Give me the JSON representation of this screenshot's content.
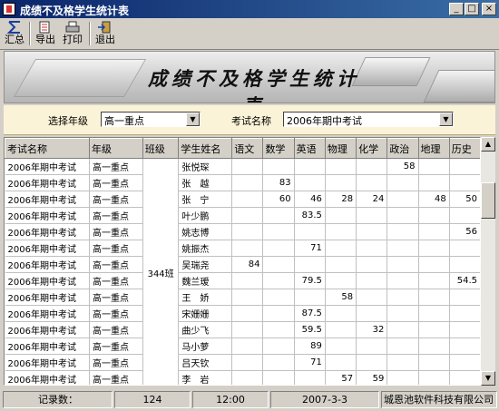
{
  "window": {
    "title": "成绩不及格学生统计表",
    "min": "_",
    "max": "□",
    "close": "×"
  },
  "toolbar": {
    "summary": "汇总",
    "export": "导出",
    "print": "打印",
    "exit": "退出"
  },
  "banner": {
    "title": "成绩不及格学生统计表"
  },
  "filters": {
    "grade_label": "选择年级",
    "grade_value": "高一重点",
    "exam_label": "考试名称",
    "exam_value": "2006年期中考试"
  },
  "table": {
    "columns": [
      "考试名称",
      "年级",
      "班级",
      "学生姓名",
      "语文",
      "数学",
      "英语",
      "物理",
      "化学",
      "政治",
      "地理",
      "历史"
    ],
    "class_name": "344班",
    "rows": [
      [
        "2006年期中考试",
        "高一重点",
        "张悦琛",
        "",
        "",
        "",
        "",
        "",
        "58",
        "",
        ""
      ],
      [
        "2006年期中考试",
        "高一重点",
        "张　越",
        "",
        "83",
        "",
        "",
        "",
        "",
        "",
        ""
      ],
      [
        "2006年期中考试",
        "高一重点",
        "张　宁",
        "",
        "60",
        "46",
        "28",
        "24",
        "",
        "48",
        "50"
      ],
      [
        "2006年期中考试",
        "高一重点",
        "叶少鹏",
        "",
        "",
        "83.5",
        "",
        "",
        "",
        "",
        ""
      ],
      [
        "2006年期中考试",
        "高一重点",
        "姚志博",
        "",
        "",
        "",
        "",
        "",
        "",
        "",
        "56"
      ],
      [
        "2006年期中考试",
        "高一重点",
        "姚振杰",
        "",
        "",
        "71",
        "",
        "",
        "",
        "",
        ""
      ],
      [
        "2006年期中考试",
        "高一重点",
        "吴瑞尧",
        "84",
        "",
        "",
        "",
        "",
        "",
        "",
        ""
      ],
      [
        "2006年期中考试",
        "高一重点",
        "魏兰瑷",
        "",
        "",
        "79.5",
        "",
        "",
        "",
        "",
        "54.5"
      ],
      [
        "2006年期中考试",
        "高一重点",
        "王　娇",
        "",
        "",
        "",
        "58",
        "",
        "",
        "",
        ""
      ],
      [
        "2006年期中考试",
        "高一重点",
        "宋姗姗",
        "",
        "",
        "87.5",
        "",
        "",
        "",
        "",
        ""
      ],
      [
        "2006年期中考试",
        "高一重点",
        "曲少飞",
        "",
        "",
        "59.5",
        "",
        "32",
        "",
        "",
        ""
      ],
      [
        "2006年期中考试",
        "高一重点",
        "马小萝",
        "",
        "",
        "89",
        "",
        "",
        "",
        "",
        ""
      ],
      [
        "2006年期中考试",
        "高一重点",
        "吕天钦",
        "",
        "",
        "71",
        "",
        "",
        "",
        "",
        ""
      ],
      [
        "2006年期中考试",
        "高一重点",
        "李　岩",
        "",
        "",
        "",
        "57",
        "59",
        "",
        "",
        ""
      ]
    ]
  },
  "status": {
    "record_label": "记录数：",
    "record_count": "124",
    "time": "12:00",
    "date": "2007-3-3",
    "company": "城恩池软件科技有限公司"
  }
}
